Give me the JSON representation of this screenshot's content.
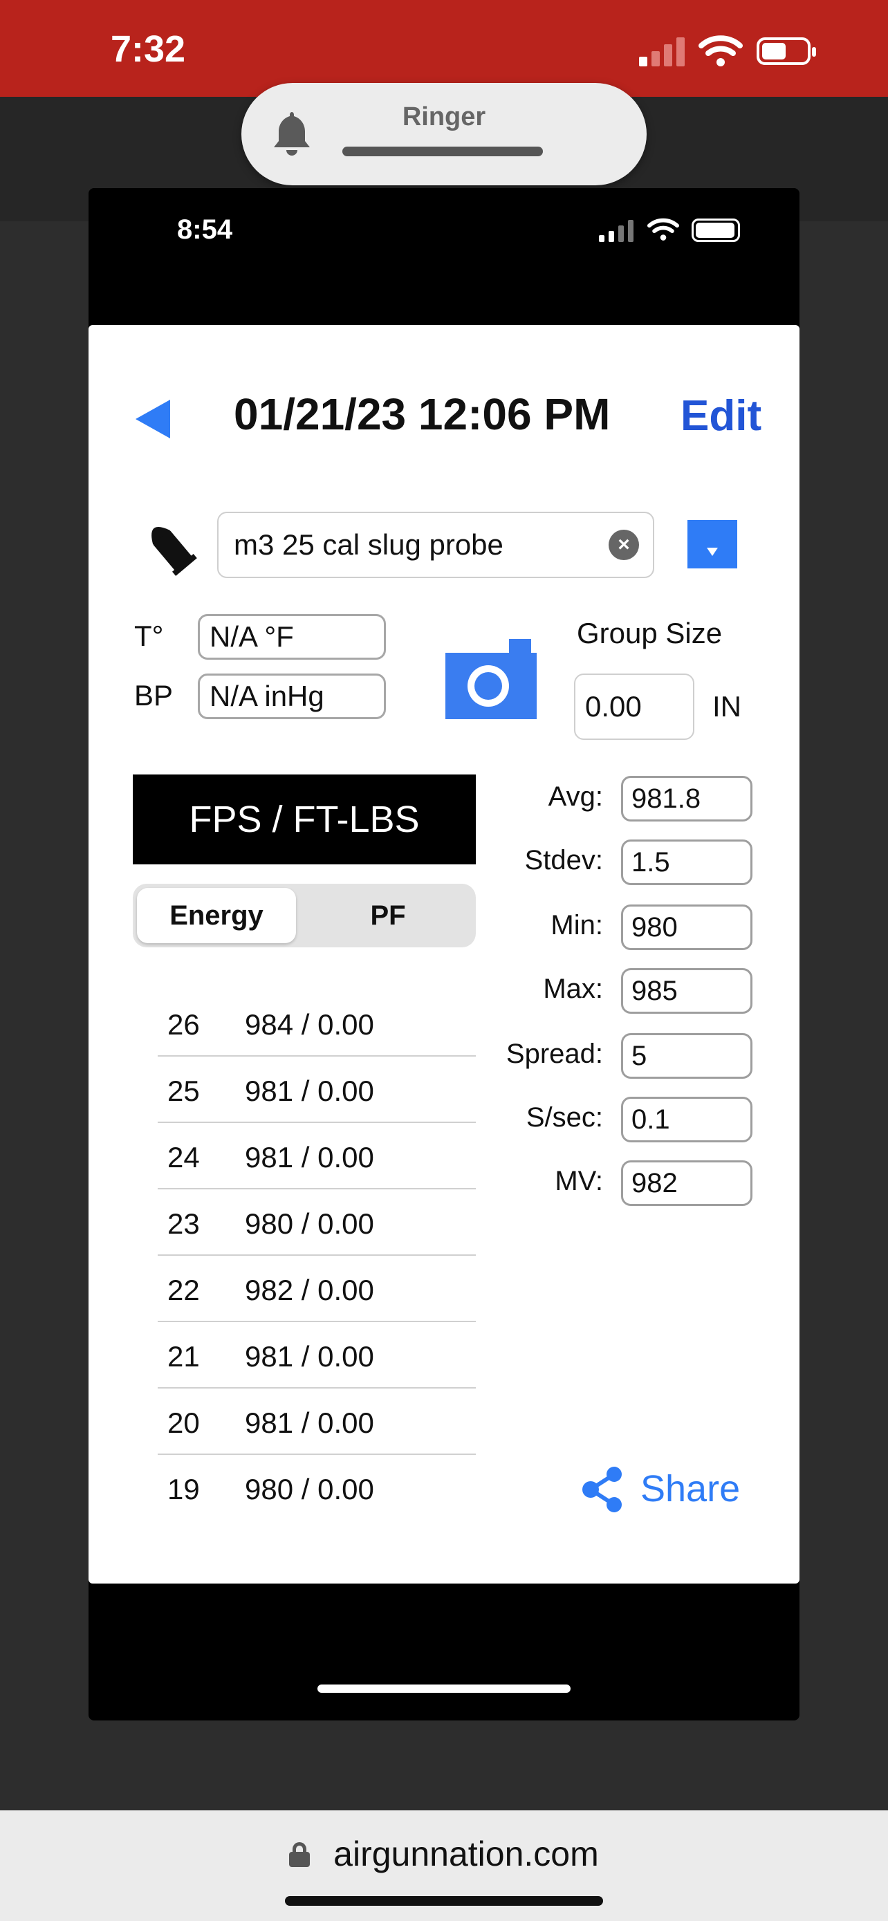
{
  "outer_status": {
    "time": "7:32"
  },
  "ringer": {
    "label": "Ringer"
  },
  "inner_status": {
    "time": "8:54"
  },
  "header": {
    "date_time": "01/21/23 12:06 PM",
    "edit_label": "Edit"
  },
  "ammo": {
    "value": "m3 25 cal slug probe"
  },
  "conditions": {
    "temp_label": "T°",
    "temp_value": "N/A °F",
    "bp_label": "BP",
    "bp_value": "N/A inHg"
  },
  "group": {
    "label": "Group Size",
    "value": "0.00",
    "unit": "IN"
  },
  "mode_header": "FPS / FT-LBS",
  "segment": {
    "options": [
      "Energy",
      "PF"
    ],
    "selected": "Energy"
  },
  "shots": [
    {
      "num": "26",
      "value": "984 / 0.00"
    },
    {
      "num": "25",
      "value": "981 / 0.00"
    },
    {
      "num": "24",
      "value": "981 / 0.00"
    },
    {
      "num": "23",
      "value": "980 / 0.00"
    },
    {
      "num": "22",
      "value": "982 / 0.00"
    },
    {
      "num": "21",
      "value": "981 / 0.00"
    },
    {
      "num": "20",
      "value": "981 / 0.00"
    },
    {
      "num": "19",
      "value": "980 / 0.00"
    }
  ],
  "stats": [
    {
      "label": "Avg:",
      "value": "981.8"
    },
    {
      "label": "Stdev:",
      "value": "1.5"
    },
    {
      "label": "Min:",
      "value": "980"
    },
    {
      "label": "Max:",
      "value": "985"
    },
    {
      "label": "Spread:",
      "value": "5"
    },
    {
      "label": "S/sec:",
      "value": "0.1"
    },
    {
      "label": "MV:",
      "value": "982"
    }
  ],
  "share_label": "Share",
  "browser": {
    "url": "airgunnation.com"
  },
  "colors": {
    "outer_status_bg": "#b8231c",
    "accent_blue": "#2f7cf6",
    "edit_blue": "#2255d6",
    "camera_blue": "#3a7df0"
  },
  "icons": [
    "back-arrow-icon",
    "bullet-icon",
    "clear-icon",
    "dropdown-icon",
    "camera-icon",
    "share-icon",
    "bell-icon",
    "lock-icon",
    "wifi-icon",
    "battery-icon",
    "signal-icon"
  ]
}
